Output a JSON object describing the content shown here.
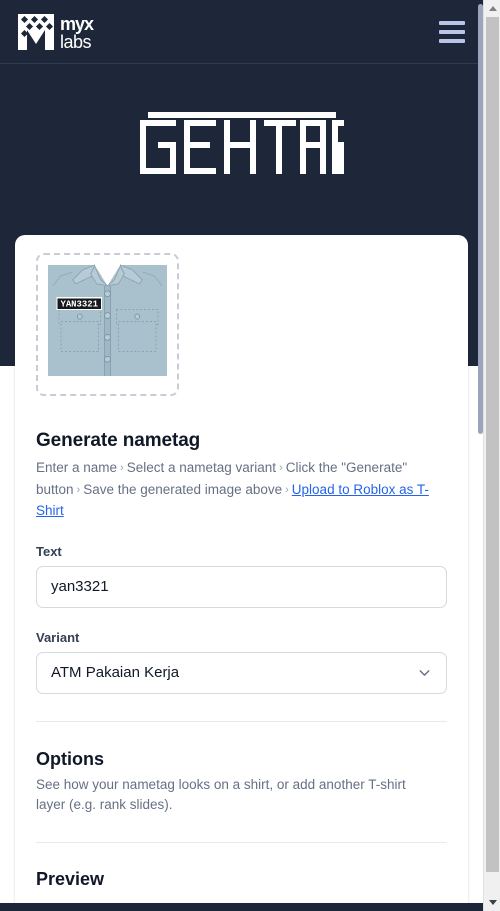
{
  "navbar": {
    "brand_name": "myx labs",
    "brand_line1": "myx",
    "brand_line2": "labs",
    "menu_icon": "hamburger-menu-icon"
  },
  "hero": {
    "wordmark": "GENTAG"
  },
  "thumbnail": {
    "alt": "shirt preview with nametag",
    "nametag_text": "YAN3321"
  },
  "generate": {
    "title": "Generate nametag",
    "steps": [
      "Enter a name",
      "Select a nametag variant",
      "Click the \"Generate\" button",
      "Save the generated image above"
    ],
    "step_separator": "›",
    "link_text": "Upload to Roblox as T-Shirt"
  },
  "text_field": {
    "label": "Text",
    "value": "yan3321",
    "placeholder": "Enter a name"
  },
  "variant_field": {
    "label": "Variant",
    "value": "ATM Pakaian Kerja",
    "chevron_icon": "chevron-down-icon"
  },
  "options": {
    "title": "Options",
    "description": "See how your nametag looks on a shirt, or add another T-shirt layer (e.g. rank slides)."
  },
  "preview": {
    "title": "Preview"
  },
  "colors": {
    "hero_bg": "#1e2739",
    "accent_link": "#2563eb",
    "hamburger": "#b9c4e8",
    "shirt_fabric": "#a9c1cd",
    "card_bg": "#ffffff"
  }
}
